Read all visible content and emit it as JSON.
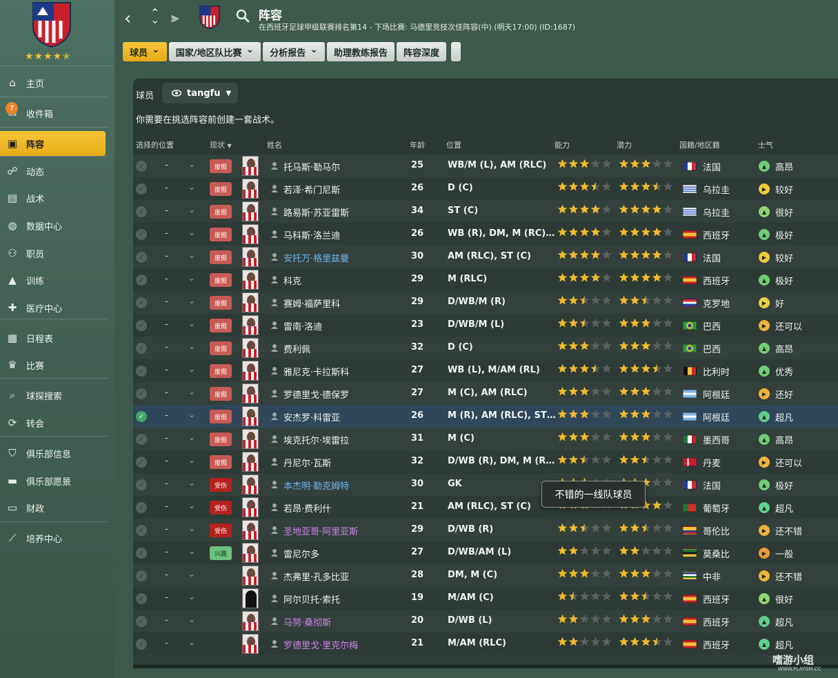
{
  "sidebar": {
    "items": [
      {
        "label": "主页",
        "icon": "home-icon"
      },
      {
        "label": "收件箱",
        "icon": "inbox-icon",
        "badge": "7"
      },
      {
        "label": "阵容",
        "icon": "squad-shirt-icon",
        "active": true
      },
      {
        "label": "动态",
        "icon": "dynamics-icon"
      },
      {
        "label": "战术",
        "icon": "tactics-board-icon"
      },
      {
        "label": "数据中心",
        "icon": "data-hub-icon"
      },
      {
        "label": "职员",
        "icon": "staff-icon"
      },
      {
        "label": "训练",
        "icon": "training-cone-icon"
      },
      {
        "label": "医疗中心",
        "icon": "medical-kit-icon"
      },
      {
        "label": "日程表",
        "icon": "calendar-icon"
      },
      {
        "label": "比赛",
        "icon": "trophy-icon"
      },
      {
        "label": "球探搜索",
        "icon": "scout-search-icon"
      },
      {
        "label": "转会",
        "icon": "transfer-icon"
      },
      {
        "label": "俱乐部信息",
        "icon": "club-shield-icon"
      },
      {
        "label": "俱乐部愿景",
        "icon": "briefcase-icon"
      },
      {
        "label": "财政",
        "icon": "finance-icon"
      },
      {
        "label": "培养中心",
        "icon": "development-graph-icon"
      }
    ],
    "club_rating": 4.5
  },
  "header": {
    "title": "阵容",
    "subtitle": "在西班牙足球甲级联赛排名第14 - 下场比赛: 马德里竞技次佳阵容(中) (明天17:00) (ID:1687)"
  },
  "toolbar": [
    {
      "label": "球员",
      "caret": true,
      "primary": true
    },
    {
      "label": "国家/地区队比赛",
      "caret": true
    },
    {
      "label": "分析报告",
      "caret": true
    },
    {
      "label": "助理教练报告",
      "caret": false
    },
    {
      "label": "阵容深度",
      "caret": false
    }
  ],
  "panel": {
    "label": "球员",
    "view": "tangfu",
    "notice": "你需要在挑选阵容前创建一套战术。"
  },
  "columns": {
    "selected_pos": "选择的位置",
    "status": "现状",
    "name": "姓名",
    "age": "年龄",
    "position": "位置",
    "ability": "能力",
    "potential": "潜力",
    "nationality": "国籍/地区籍",
    "morale": "士气"
  },
  "colors": {
    "accent": "#f2bb2c",
    "panel": "#2c3834",
    "sidebar": "#4a6b5d"
  },
  "players": [
    {
      "name": "托马斯·勒马尔",
      "age": "25",
      "pos": "WB/M (L), AM (RLC)",
      "ca": 3,
      "pa": 3,
      "nat": "法国",
      "flag": "fr",
      "morale": "高昂",
      "mood": "up",
      "status": "度假",
      "st": "vac",
      "nc": ""
    },
    {
      "name": "若泽·希门尼斯",
      "age": "26",
      "pos": "D (C)",
      "ca": 3.5,
      "pa": 3.5,
      "nat": "乌拉圭",
      "flag": "uy",
      "morale": "较好",
      "mood": "right",
      "status": "度假",
      "st": "vac",
      "nc": ""
    },
    {
      "name": "路易斯·苏亚雷斯",
      "age": "34",
      "pos": "ST (C)",
      "ca": 4,
      "pa": 4,
      "nat": "乌拉圭",
      "flag": "uy",
      "morale": "很好",
      "mood": "up",
      "status": "度假",
      "st": "vac",
      "nc": ""
    },
    {
      "name": "马科斯·洛兰迪",
      "age": "26",
      "pos": "WB (R), DM, M (RC), AM (R)",
      "ca": 4,
      "pa": 4,
      "nat": "西班牙",
      "flag": "es",
      "morale": "极好",
      "mood": "up",
      "status": "度假",
      "st": "vac",
      "nc": ""
    },
    {
      "name": "安托万·格里兹曼",
      "age": "30",
      "pos": "AM (RLC), ST (C)",
      "ca": 4,
      "pa": 4,
      "nat": "法国",
      "flag": "fr",
      "morale": "较好",
      "mood": "right",
      "status": "度假",
      "st": "vac",
      "nc": "blue"
    },
    {
      "name": "科克",
      "age": "29",
      "pos": "M (RLC)",
      "ca": 4,
      "pa": 4,
      "nat": "西班牙",
      "flag": "es",
      "morale": "极好",
      "mood": "up",
      "status": "度假",
      "st": "vac",
      "nc": ""
    },
    {
      "name": "赛姆·福萨里科",
      "age": "29",
      "pos": "D/WB/M (R)",
      "ca": 2.5,
      "pa": 2.5,
      "nat": "克罗地",
      "flag": "hr",
      "morale": "好",
      "mood": "right",
      "status": "度假",
      "st": "vac",
      "nc": ""
    },
    {
      "name": "雷南·洛迪",
      "age": "23",
      "pos": "D/WB/M (L)",
      "ca": 2.5,
      "pa": 3,
      "nat": "巴西",
      "flag": "br",
      "morale": "还可以",
      "mood": "right",
      "status": "度假",
      "st": "vac",
      "nc": ""
    },
    {
      "name": "费利佩",
      "age": "32",
      "pos": "D (C)",
      "ca": 3,
      "pa": 3,
      "nat": "巴西",
      "flag": "br",
      "morale": "高昂",
      "mood": "up",
      "status": "度假",
      "st": "vac",
      "nc": ""
    },
    {
      "name": "雅尼克·卡拉斯科",
      "age": "27",
      "pos": "WB (L), M/AM (RL)",
      "ca": 3.5,
      "pa": 3.5,
      "nat": "比利时",
      "flag": "be",
      "morale": "优秀",
      "mood": "up",
      "status": "度假",
      "st": "vac",
      "nc": ""
    },
    {
      "name": "罗德里戈·德保罗",
      "age": "27",
      "pos": "M (C), AM (RLC)",
      "ca": 3,
      "pa": 3,
      "nat": "阿根廷",
      "flag": "ar",
      "morale": "还好",
      "mood": "right",
      "status": "度假",
      "st": "vac",
      "nc": ""
    },
    {
      "name": "安杰罗·科雷亚",
      "age": "26",
      "pos": "M (R), AM (RLC), ST (C)",
      "ca": 3,
      "pa": 3,
      "nat": "阿根廷",
      "flag": "ar",
      "morale": "超凡",
      "mood": "up",
      "status": "度假",
      "st": "vac",
      "nc": "",
      "selected": true
    },
    {
      "name": "埃克托尔·埃雷拉",
      "age": "31",
      "pos": "M (C)",
      "ca": 3,
      "pa": 3,
      "nat": "墨西哥",
      "flag": "mx",
      "morale": "高昂",
      "mood": "up",
      "status": "度假",
      "st": "vac",
      "nc": ""
    },
    {
      "name": "丹尼尔·瓦斯",
      "age": "32",
      "pos": "D/WB (R), DM, M (RLC)",
      "ca": 2.5,
      "pa": 2.5,
      "nat": "丹麦",
      "flag": "dk",
      "morale": "还可以",
      "mood": "right",
      "status": "度假",
      "st": "vac",
      "nc": ""
    },
    {
      "name": "本杰明·勒克姆特",
      "age": "30",
      "pos": "GK",
      "ca": 3,
      "pa": 3,
      "nat": "法国",
      "flag": "fr",
      "morale": "极好",
      "mood": "up",
      "status": "受伤",
      "st": "inj",
      "nc": "blue"
    },
    {
      "name": "若昂·费利什",
      "age": "21",
      "pos": "AM (RLC), ST (C)",
      "ca": 3,
      "pa": 4,
      "nat": "葡萄牙",
      "flag": "pt",
      "morale": "超凡",
      "mood": "up",
      "status": "受伤",
      "st": "inj",
      "nc": ""
    },
    {
      "name": "圣地亚哥·阿里亚斯",
      "age": "29",
      "pos": "D/WB (R)",
      "ca": 2.5,
      "pa": 2.5,
      "nat": "哥伦比",
      "flag": "co",
      "morale": "还不错",
      "mood": "right",
      "status": "受伤",
      "st": "inj",
      "nc": "purple"
    },
    {
      "name": "雷尼尔多",
      "age": "27",
      "pos": "D/WB/AM (L)",
      "ca": 2,
      "pa": 2,
      "nat": "莫桑比",
      "flag": "mz",
      "morale": "一般",
      "mood": "right",
      "status": "兴趣",
      "st": "int",
      "nc": ""
    },
    {
      "name": "杰弗里·孔多比亚",
      "age": "28",
      "pos": "DM, M (C)",
      "ca": 3,
      "pa": 3,
      "nat": "中非",
      "flag": "cf",
      "morale": "还不错",
      "mood": "right",
      "status": "",
      "st": "",
      "nc": ""
    },
    {
      "name": "阿尔贝托·索托",
      "age": "19",
      "pos": "M/AM (C)",
      "ca": 1.5,
      "pa": 2.5,
      "nat": "西班牙",
      "flag": "es",
      "morale": "很好",
      "mood": "up",
      "status": "",
      "st": "",
      "nc": "",
      "nophoto": true
    },
    {
      "name": "马努·桑彻斯",
      "age": "20",
      "pos": "D/WB (L)",
      "ca": 2,
      "pa": 3,
      "nat": "西班牙",
      "flag": "es",
      "morale": "超凡",
      "mood": "up",
      "status": "",
      "st": "",
      "nc": "purple"
    },
    {
      "name": "罗德里戈·里克尔梅",
      "age": "21",
      "pos": "M/AM (RLC)",
      "ca": 2,
      "pa": 3.5,
      "nat": "西班牙",
      "flag": "es",
      "morale": "超凡",
      "mood": "up",
      "status": "",
      "st": "",
      "nc": "purple"
    }
  ],
  "tooltip": "不错的一线队球员",
  "watermark": {
    "main": "嗜游小组",
    "sub": "WWW.PLAYGM.CC"
  }
}
